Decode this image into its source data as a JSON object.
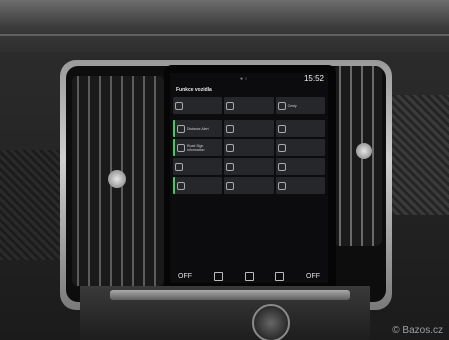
{
  "screen": {
    "time": "15:52",
    "title": "Funkce vozidla",
    "tiles": [
      "",
      "",
      "Cesty",
      "Distance Alert",
      "",
      "",
      "Road Sign Information",
      "",
      "",
      "",
      "",
      "",
      "",
      "",
      ""
    ],
    "bottom_left": "OFF",
    "bottom_right": "OFF"
  },
  "watermark": "© Bazos.cz",
  "colors": {
    "active": "#3bcf5f",
    "tile": "#26272b"
  }
}
